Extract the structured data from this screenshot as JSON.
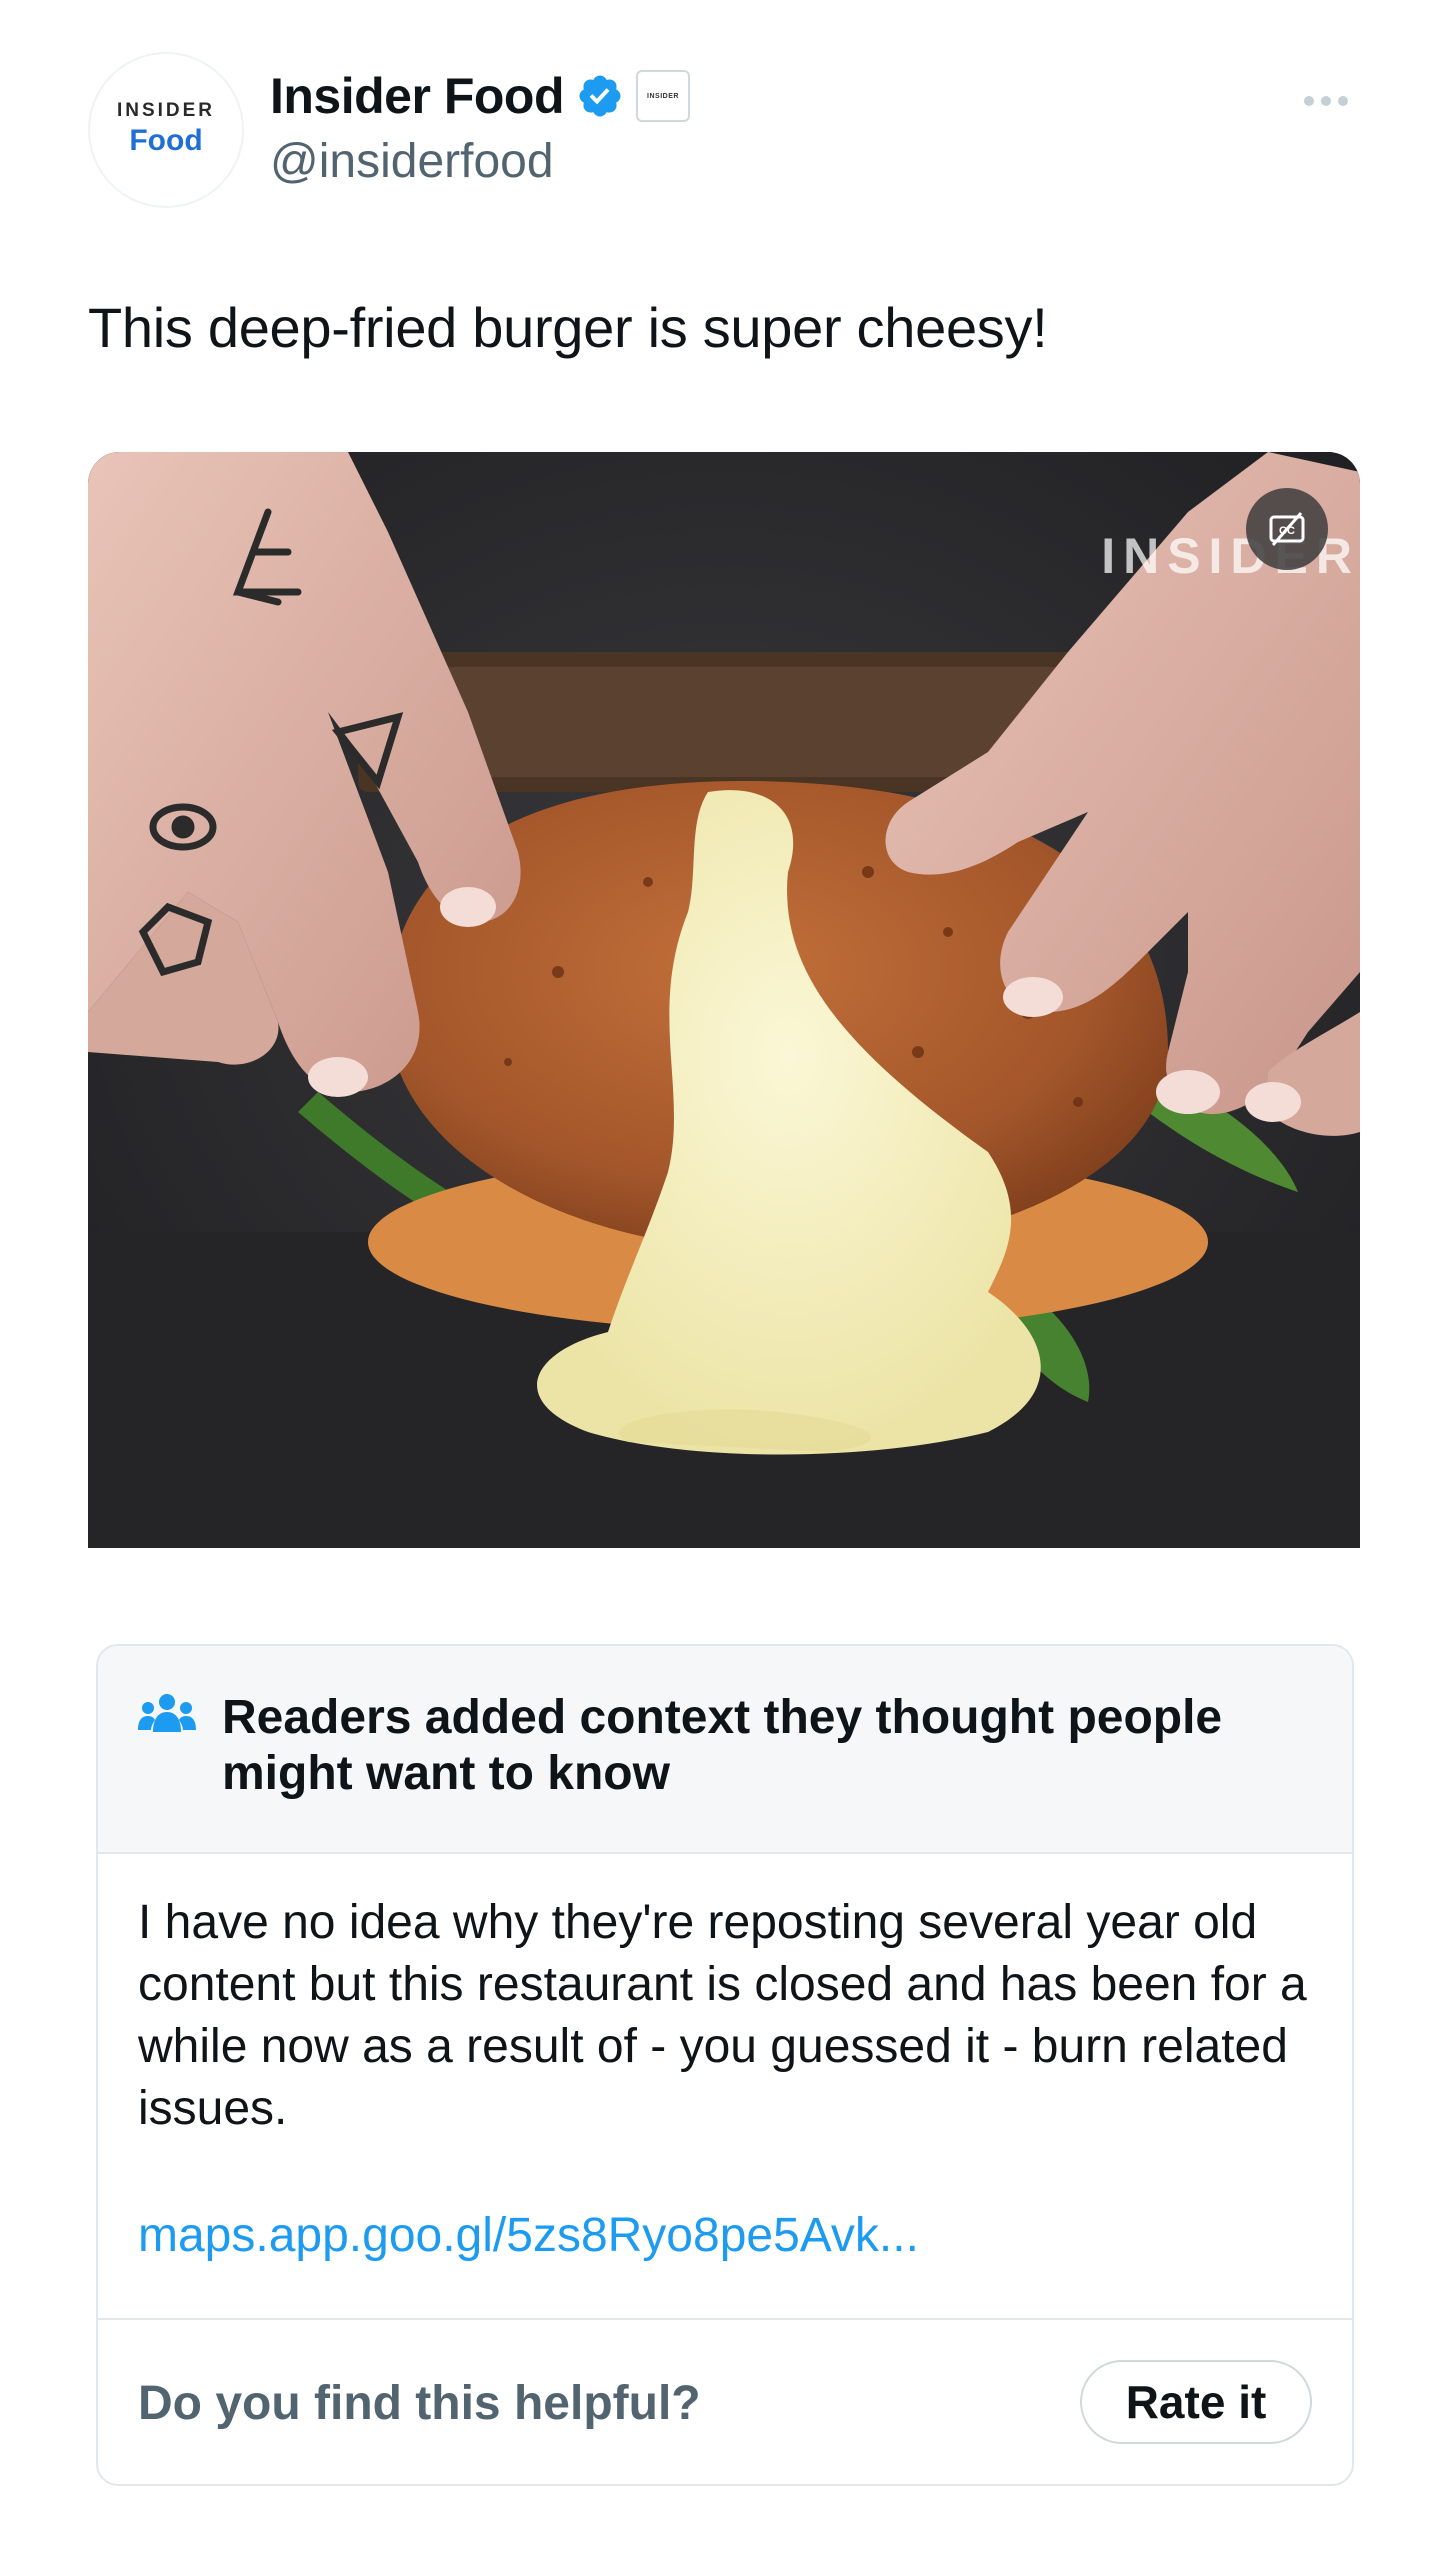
{
  "author": {
    "avatar_line1": "INSIDER",
    "avatar_line2": "Food",
    "display_name": "Insider Food",
    "handle": "@insiderfood",
    "affiliate_badge_text": "INSIDER",
    "verified_color": "#1d9bf0"
  },
  "tweet": {
    "text": "This deep-fried burger is super cheesy!"
  },
  "media": {
    "watermark": "INSIDER",
    "captions_icon": "closed-captions-off-icon"
  },
  "community_note": {
    "title": "Readers added context they thought people might want to know",
    "body": "I have no idea why they're reposting several year old content but this restaurant is closed and has been for a while now as a result of - you guessed it - burn related issues.",
    "link": "maps.app.goo.gl/5zs8Ryo8pe5Avk...",
    "helpful_prompt": "Do you find this helpful?",
    "rate_label": "Rate it",
    "link_color": "#1d9bf0",
    "icon": "people-icon"
  }
}
